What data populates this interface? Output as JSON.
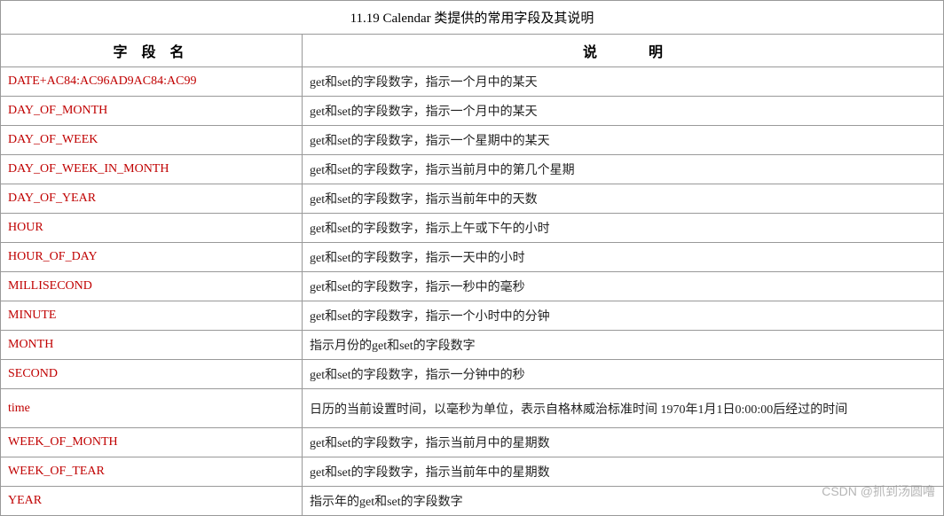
{
  "title": "11.19  Calendar 类提供的常用字段及其说明",
  "header": {
    "field": "字 段 名",
    "desc_a": "说",
    "desc_b": "明"
  },
  "rows": [
    {
      "field": "DATE+AC84:AC96AD9AC84:AC99",
      "desc": "get和set的字段数字，指示一个月中的某天"
    },
    {
      "field": "DAY_OF_MONTH",
      "desc": "get和set的字段数字，指示一个月中的某天"
    },
    {
      "field": "DAY_OF_WEEK",
      "desc": "get和set的字段数字，指示一个星期中的某天"
    },
    {
      "field": "DAY_OF_WEEK_IN_MONTH",
      "desc": "get和set的字段数字，指示当前月中的第几个星期"
    },
    {
      "field": "DAY_OF_YEAR",
      "desc": "get和set的字段数字，指示当前年中的天数"
    },
    {
      "field": "HOUR",
      "desc": "get和set的字段数字，指示上午或下午的小时"
    },
    {
      "field": "HOUR_OF_DAY",
      "desc": "get和set的字段数字，指示一天中的小时"
    },
    {
      "field": "MILLISECOND",
      "desc": "get和set的字段数字，指示一秒中的毫秒"
    },
    {
      "field": "MINUTE",
      "desc": "get和set的字段数字，指示一个小时中的分钟"
    },
    {
      "field": "MONTH",
      "desc": "指示月份的get和set的字段数字"
    },
    {
      "field": "SECOND",
      "desc": "get和set的字段数字，指示一分钟中的秒"
    },
    {
      "field": "time",
      "desc": "日历的当前设置时间，以毫秒为单位，表示自格林威治标准时间 1970年1月1日0:00:00后经过的时间"
    },
    {
      "field": "WEEK_OF_MONTH",
      "desc": "get和set的字段数字，指示当前月中的星期数"
    },
    {
      "field": "WEEK_OF_TEAR",
      "desc": "get和set的字段数字，指示当前年中的星期数"
    },
    {
      "field": "YEAR",
      "desc": "指示年的get和set的字段数字"
    }
  ],
  "watermark": "CSDN @抓到汤圆噜"
}
